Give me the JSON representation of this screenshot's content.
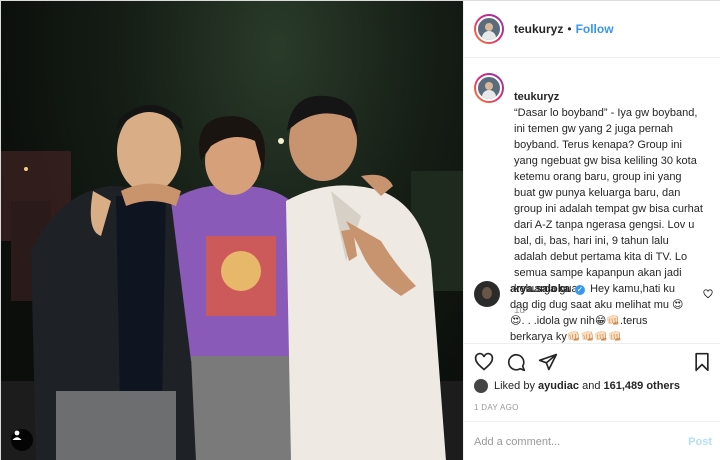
{
  "header": {
    "username": "teukuryz",
    "separator": "•",
    "follow_label": "Follow"
  },
  "caption": {
    "username": "teukuryz",
    "text": "“Dasar lo boyband” - Iya gw boyband, ini temen gw yang 2 juga pernah boyband. Terus kenapa? Group ini yang ngebuat gw bisa keliling 30 kota ketemu orang baru, group ini yang buat gw punya keluarga baru, dan group ini adalah tempat gw bisa curhat dari A-Z tanpa ngerasa gengsi. Lov u bal, di, bas, hari ini, 9 tahun lalu adalah debut pertama kita di TV. Lo semua sampe kapanpun akan jadi keluarga gua.",
    "time": "1d"
  },
  "comment": {
    "username": "arya.saloka",
    "verified_glyph": "✓",
    "text": "Hey kamu,hati ku dag dig dug saat aku melihat mu 😍😍. . .idola gw nih😁👊🏻.terus berkarya ky👊🏻👊🏻👊🏻👊🏻"
  },
  "likes": {
    "prefix": "Liked by",
    "first_user": "ayudiac",
    "connector": "and",
    "count": "161,489 others"
  },
  "timestamp": "1 DAY AGO",
  "add_comment": {
    "placeholder": "Add a comment...",
    "post_label": "Post"
  },
  "icons": {
    "heart": "heart-icon",
    "comment": "comment-icon",
    "share": "share-icon",
    "save": "bookmark-icon",
    "user_tag": "user-tag-icon"
  },
  "colors": {
    "accent": "#3897f0",
    "post_disabled": "#b2dffc",
    "muted": "#999999",
    "border": "#efefef"
  }
}
